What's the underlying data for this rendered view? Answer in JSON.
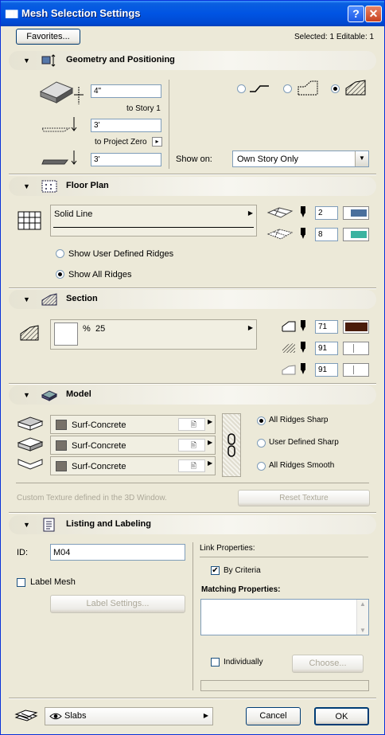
{
  "window": {
    "title": "Mesh Selection Settings",
    "app_icon": "archicad-icon",
    "help_label": "?",
    "close_label": "✕"
  },
  "top": {
    "favorites_label": "Favorites...",
    "selected_status": "Selected: 1 Editable: 1"
  },
  "geometry": {
    "title": "Geometry and Positioning",
    "top_offset": "4\"",
    "to_story_label": "to Story 1",
    "elevation": "3'",
    "to_project_zero_label": "to Project Zero",
    "bottom_value": "3'",
    "show_on_label": "Show on:",
    "show_on_value": "Own Story Only",
    "structure_options": [
      "surface-only",
      "with-sides",
      "solid"
    ],
    "selected_structure": "solid"
  },
  "floor_plan": {
    "title": "Floor Plan",
    "line_type": "Solid Line",
    "top_pen": "2",
    "bottom_pen": "8",
    "top_color": "#4a6f9c",
    "bottom_color": "#3ab3a0",
    "ridges_option_user": "Show User Defined Ridges",
    "ridges_option_all": "Show All Ridges",
    "selected_ridges": "all"
  },
  "section": {
    "title": "Section",
    "fill_percent_label": "%",
    "fill_percent_value": "25",
    "cut_pen": "71",
    "fill_pen": "91",
    "bg_pen": "91",
    "cut_color": "#4a1c0a"
  },
  "model": {
    "title": "Model",
    "materials": [
      {
        "name": "Surf-Concrete"
      },
      {
        "name": "Surf-Concrete"
      },
      {
        "name": "Surf-Concrete"
      }
    ],
    "ridge_options": [
      "All Ridges Sharp",
      "User Defined Sharp",
      "All Ridges Smooth"
    ],
    "selected_ridge": "All Ridges Sharp",
    "texture_note": "Custom Texture defined in the 3D Window.",
    "reset_texture_label": "Reset Texture"
  },
  "listing": {
    "title": "Listing and Labeling",
    "id_label": "ID:",
    "id_value": "M04",
    "label_mesh_label": "Label Mesh",
    "label_settings_label": "Label Settings...",
    "link_properties_label": "Link Properties:",
    "by_criteria_label": "By Criteria",
    "matching_properties_label": "Matching Properties:",
    "individually_label": "Individually",
    "choose_label": "Choose..."
  },
  "footer": {
    "layer_name": "Slabs",
    "cancel_label": "Cancel",
    "ok_label": "OK"
  }
}
